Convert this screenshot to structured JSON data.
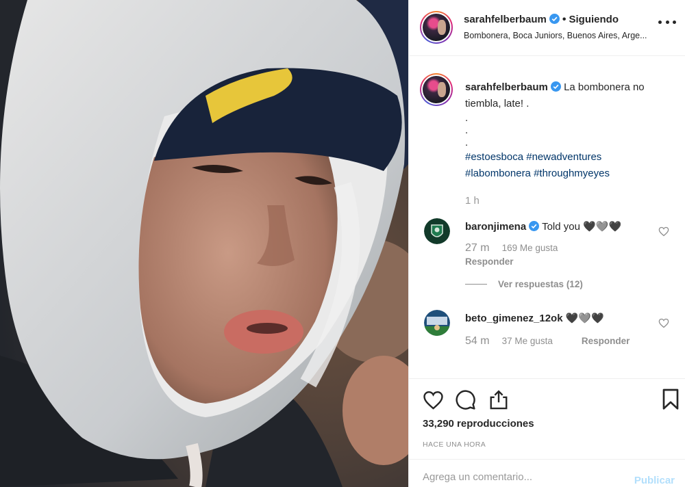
{
  "post": {
    "author": "sarahfelberbaum",
    "follow_state": "Siguiendo",
    "location": "Bombonera, Boca Juniors, Buenos Aires, Arge..."
  },
  "caption": {
    "username": "sarahfelberbaum",
    "text_line1": "La bombonera no",
    "text_line2": "tiembla, late! .",
    "dots": [
      ".",
      ".",
      "."
    ],
    "hashtags_line1": "#estoesboca #newadventures",
    "hashtags_line2": "#labombonera #throughmyeyes",
    "time_ago": "1 h"
  },
  "comments": [
    {
      "username": "baronjimena",
      "text": "Told you 🖤🩶🖤",
      "age": "27 m",
      "likes": "169 Me gusta",
      "reply_label": "Responder",
      "view_replies": "Ver respuestas (12)"
    },
    {
      "username": "beto_gimenez_12ok",
      "text": "🖤🩶🖤",
      "age": "54 m",
      "likes": "37 Me gusta",
      "reply_label": "Responder"
    }
  ],
  "stats": {
    "views": "33,290 reproducciones",
    "timestamp": "HACE UNA HORA"
  },
  "add_comment": {
    "placeholder": "Agrega un comentario...",
    "publish_label": "Publicar"
  },
  "colors": {
    "verified": "#3897f0",
    "hashtag": "#003569",
    "muted": "#8e8e8e",
    "publish_disabled": "#b2dffc"
  },
  "icons": [
    "verified-badge-icon",
    "more-options-icon",
    "heart-icon",
    "comment-icon",
    "share-icon",
    "bookmark-icon"
  ]
}
